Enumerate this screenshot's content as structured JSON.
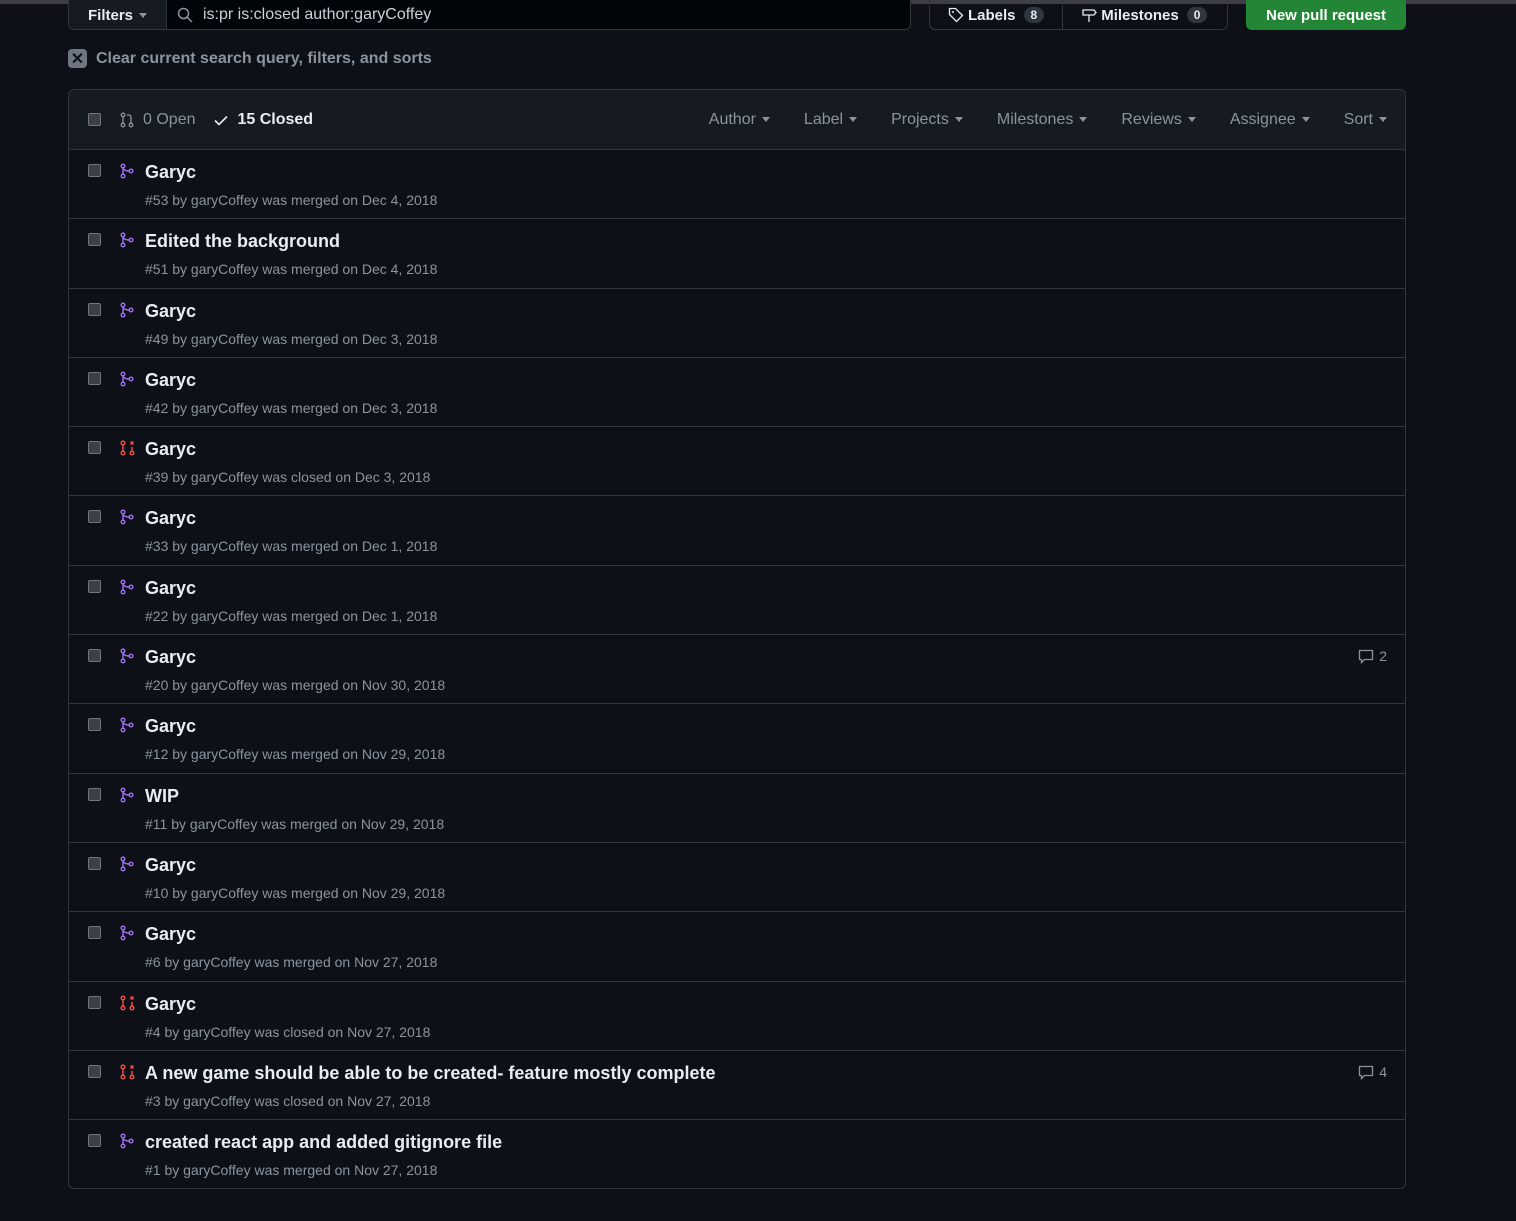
{
  "toolbar": {
    "filters": "Filters",
    "search_value": "is:pr is:closed author:garyCoffey",
    "labels": "Labels",
    "labels_count": "8",
    "milestones": "Milestones",
    "milestones_count": "0",
    "new_pr": "New pull request"
  },
  "clear": "Clear current search query, filters, and sorts",
  "header": {
    "open": "0 Open",
    "closed": "15 Closed",
    "menus": [
      "Author",
      "Label",
      "Projects",
      "Milestones",
      "Reviews",
      "Assignee",
      "Sort"
    ]
  },
  "colors": {
    "merged": "#a371f7",
    "closed": "#f85149",
    "accent": "#238636"
  },
  "prs": [
    {
      "title": "Garyc",
      "meta": "#53 by garyCoffey was merged on Dec 4, 2018",
      "state": "merged",
      "comments": ""
    },
    {
      "title": "Edited the background",
      "meta": "#51 by garyCoffey was merged on Dec 4, 2018",
      "state": "merged",
      "comments": ""
    },
    {
      "title": "Garyc",
      "meta": "#49 by garyCoffey was merged on Dec 3, 2018",
      "state": "merged",
      "comments": ""
    },
    {
      "title": "Garyc",
      "meta": "#42 by garyCoffey was merged on Dec 3, 2018",
      "state": "merged",
      "comments": ""
    },
    {
      "title": "Garyc",
      "meta": "#39 by garyCoffey was closed on Dec 3, 2018",
      "state": "closed",
      "comments": ""
    },
    {
      "title": "Garyc",
      "meta": "#33 by garyCoffey was merged on Dec 1, 2018",
      "state": "merged",
      "comments": ""
    },
    {
      "title": "Garyc",
      "meta": "#22 by garyCoffey was merged on Dec 1, 2018",
      "state": "merged",
      "comments": ""
    },
    {
      "title": "Garyc",
      "meta": "#20 by garyCoffey was merged on Nov 30, 2018",
      "state": "merged",
      "comments": "2"
    },
    {
      "title": "Garyc",
      "meta": "#12 by garyCoffey was merged on Nov 29, 2018",
      "state": "merged",
      "comments": ""
    },
    {
      "title": "WIP",
      "meta": "#11 by garyCoffey was merged on Nov 29, 2018",
      "state": "merged",
      "comments": ""
    },
    {
      "title": "Garyc",
      "meta": "#10 by garyCoffey was merged on Nov 29, 2018",
      "state": "merged",
      "comments": ""
    },
    {
      "title": "Garyc",
      "meta": "#6 by garyCoffey was merged on Nov 27, 2018",
      "state": "merged",
      "comments": ""
    },
    {
      "title": "Garyc",
      "meta": "#4 by garyCoffey was closed on Nov 27, 2018",
      "state": "closed",
      "comments": ""
    },
    {
      "title": "A new game should be able to be created- feature mostly complete",
      "meta": "#3 by garyCoffey was closed on Nov 27, 2018",
      "state": "closed",
      "comments": "4"
    },
    {
      "title": "created react app and added gitignore file",
      "meta": "#1 by garyCoffey was merged on Nov 27, 2018",
      "state": "merged",
      "comments": ""
    }
  ]
}
